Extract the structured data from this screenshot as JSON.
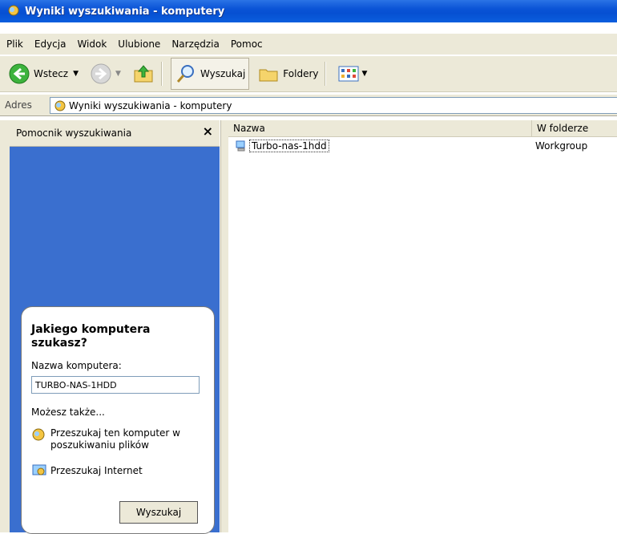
{
  "window": {
    "title": "Wyniki wyszukiwania - komputery"
  },
  "menu": [
    "Plik",
    "Edycja",
    "Widok",
    "Ulubione",
    "Narzędzia",
    "Pomoc"
  ],
  "toolbar": {
    "back": "Wstecz",
    "search": "Wyszukaj",
    "folders": "Foldery"
  },
  "address": {
    "label": "Adres",
    "value": "Wyniki wyszukiwania - komputery"
  },
  "panel": {
    "title": "Pomocnik wyszukiwania",
    "close": "×",
    "question": "Jakiego komputera szukasz?",
    "field_label": "Nazwa komputera:",
    "field_value": "TURBO-NAS-1HDD",
    "also": "Możesz także...",
    "link1": "Przeszukaj ten komputer w poszukiwaniu plików",
    "link2": "Przeszukaj Internet",
    "search_button": "Wyszukaj"
  },
  "list": {
    "columns": [
      "Nazwa",
      "W folderze"
    ],
    "rows": [
      {
        "name": "Turbo-nas-1hdd",
        "folder": "Workgroup"
      }
    ]
  }
}
